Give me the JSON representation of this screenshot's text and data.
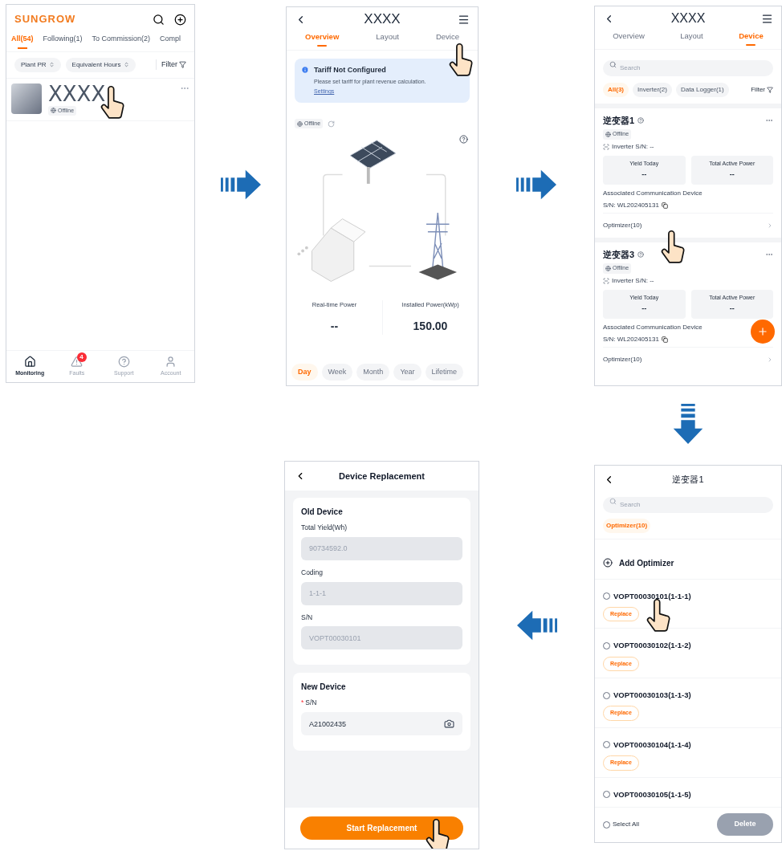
{
  "plant_list_screen": {
    "logo": "SUNGROW",
    "tabs": [
      {
        "label": "All(54)",
        "selected": true
      },
      {
        "label": "Following(1)",
        "selected": false
      },
      {
        "label": "To Commission(2)",
        "selected": false
      },
      {
        "label": "Compl",
        "selected": false
      }
    ],
    "sort_chips": [
      "Plant PR",
      "Equivalent Hours"
    ],
    "filter": "Filter",
    "plants": [
      {
        "name": "XXXX",
        "status": "Offline"
      }
    ],
    "nav": [
      {
        "label": "Monitoring",
        "selected": true
      },
      {
        "label": "Faults",
        "selected": false,
        "badge": "4"
      },
      {
        "label": "Support",
        "selected": false
      },
      {
        "label": "Account",
        "selected": false
      }
    ]
  },
  "plant_overview_screen": {
    "title": "XXXX",
    "tabs": [
      {
        "label": "Overview",
        "selected": true
      },
      {
        "label": "Layout",
        "selected": false
      },
      {
        "label": "Device",
        "selected": false
      }
    ],
    "alert": {
      "title": "Tariff Not Configured",
      "message": "Please set tariff for plant revenue calculation.",
      "link": "Settings"
    },
    "status": "Offline",
    "stats": [
      {
        "label": "Real-time Power",
        "value": "--"
      },
      {
        "label": "Installed Power(kWp)",
        "value": "150.00"
      }
    ],
    "periods": [
      {
        "label": "Day",
        "selected": true
      },
      {
        "label": "Week",
        "selected": false
      },
      {
        "label": "Month",
        "selected": false
      },
      {
        "label": "Year",
        "selected": false
      },
      {
        "label": "Lifetime",
        "selected": false
      }
    ]
  },
  "device_list_screen": {
    "title": "XXXX",
    "tabs": [
      {
        "label": "Overview",
        "selected": false
      },
      {
        "label": "Layout",
        "selected": false
      },
      {
        "label": "Device",
        "selected": true
      }
    ],
    "search": {
      "placeholder": "Search"
    },
    "filters": [
      {
        "label": "All(3)",
        "selected": true
      },
      {
        "label": "Inverter(2)",
        "selected": false
      },
      {
        "label": "Data Logger(1)",
        "selected": false
      }
    ],
    "filter": "Filter",
    "devices": [
      {
        "name": "逆变器1",
        "status": "Offline",
        "serial": "Inverter S/N: --",
        "metrics": [
          {
            "label": "Yield Today",
            "value": "--"
          },
          {
            "label": "Total Active Power",
            "value": "--"
          }
        ],
        "comm_label": "Associated Communication Device",
        "comm_serial": "S/N: WL202405131",
        "sub_link": "Optimizer(10)"
      },
      {
        "name": "逆变器3",
        "status": "Offline",
        "serial": "Inverter S/N: --",
        "metrics": [
          {
            "label": "Yield Today",
            "value": "--"
          },
          {
            "label": "Total Active Power",
            "value": "--"
          }
        ],
        "comm_label": "Associated Communication Device",
        "comm_serial": "S/N: WL202405131",
        "sub_link": "Optimizer(10)"
      }
    ]
  },
  "device_replacement_screen": {
    "title": "Device Replacement",
    "sections": [
      {
        "title": "Old Device",
        "fields": [
          {
            "label": "Total Yield(Wh)",
            "value": "90734592.0",
            "disabled": true
          },
          {
            "label": "Coding",
            "value": "1-1-1",
            "disabled": true
          },
          {
            "label": "S/N",
            "value": "VOPT00030101",
            "disabled": true
          }
        ]
      },
      {
        "title": "New Device",
        "fields": [
          {
            "label": "S/N",
            "required_mark": "*",
            "value": "A21002435",
            "disabled": false,
            "scan": true
          }
        ]
      }
    ],
    "submit": "Start Replacement"
  },
  "optimizer_list_screen": {
    "title": "逆变器1",
    "search": {
      "placeholder": "Search"
    },
    "chips": [
      {
        "label": "Optimizer(10)",
        "selected": true
      }
    ],
    "add_label": "Add Optimizer",
    "items": [
      {
        "name": "VOPT00030101(1-1-1)",
        "checked": false,
        "action": "Replace"
      },
      {
        "name": "VOPT00030102(1-1-2)",
        "checked": false,
        "action": "Replace"
      },
      {
        "name": "VOPT00030103(1-1-3)",
        "checked": false,
        "action": "Replace"
      },
      {
        "name": "VOPT00030104(1-1-4)",
        "checked": false,
        "action": "Replace"
      },
      {
        "name": "VOPT00030105(1-1-5)",
        "checked": false
      }
    ],
    "select_all": {
      "label": "Select All",
      "checked": false
    },
    "delete": {
      "label": "Delete",
      "disabled": true
    }
  }
}
